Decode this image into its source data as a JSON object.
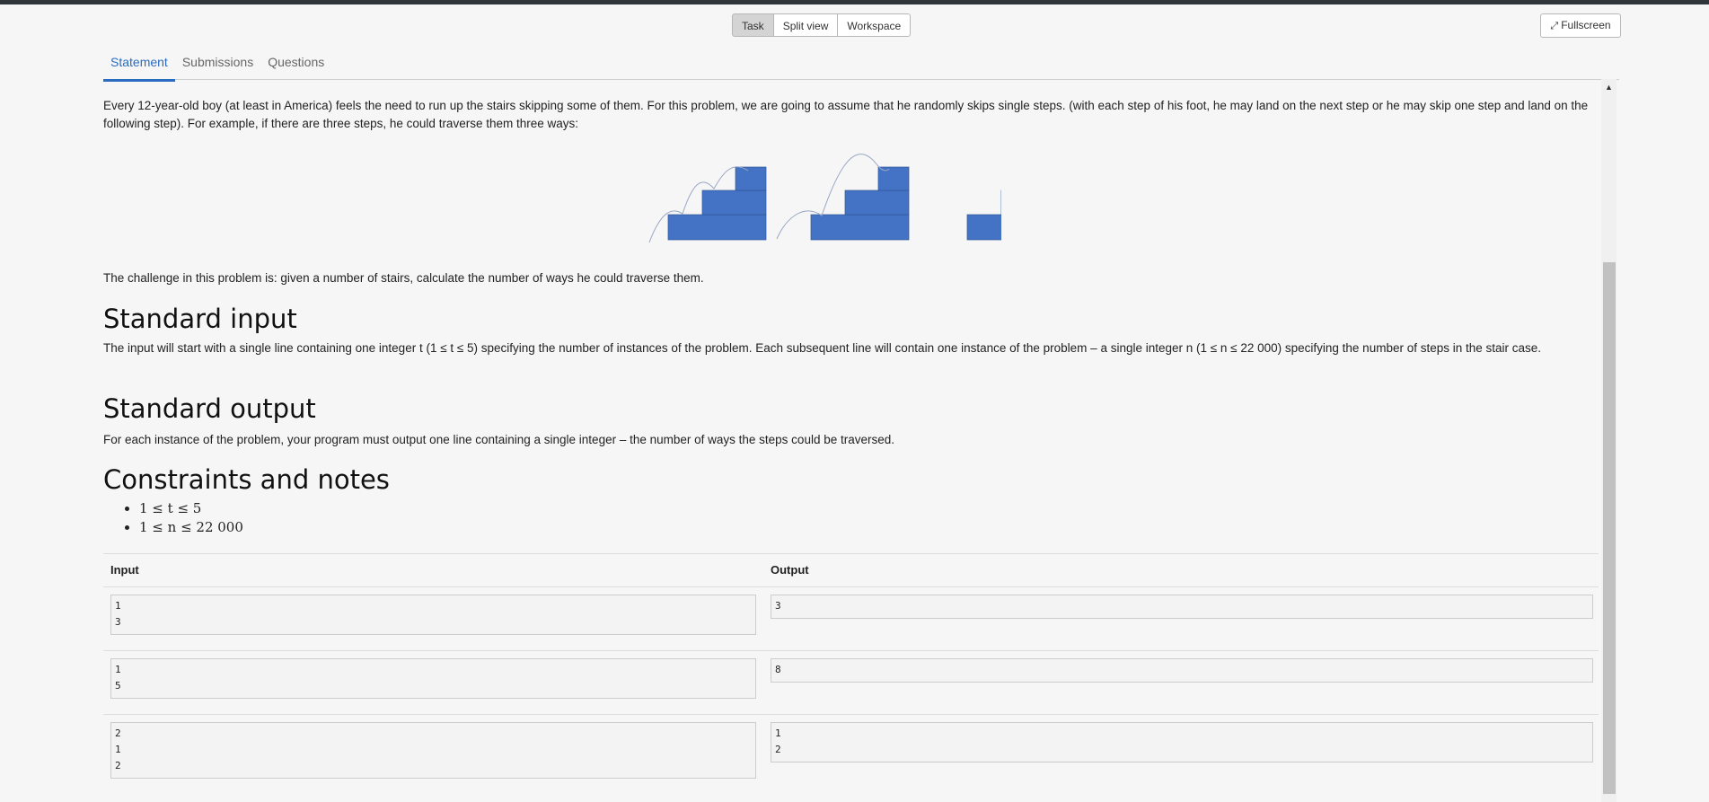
{
  "view_tabs": [
    {
      "label": "Task",
      "active": true
    },
    {
      "label": "Split view",
      "active": false
    },
    {
      "label": "Workspace",
      "active": false
    }
  ],
  "fullscreen_label": "Fullscreen",
  "statement_tabs": [
    {
      "label": "Statement",
      "active": true
    },
    {
      "label": "Submissions",
      "active": false
    },
    {
      "label": "Questions",
      "active": false
    }
  ],
  "statement": {
    "intro": "Every 12-year-old boy (at least in America) feels the need to run up the stairs skipping some of them. For this problem, we are going to assume that he randomly skips single steps. (with each step of his foot, he may land on the next step or he may skip one step and land on the following step). For example, if there are three steps, he could traverse them three ways:",
    "challenge": "The challenge in this problem is: given a number of stairs, calculate the number of ways he could traverse them.",
    "input_title": "Standard input",
    "input_text": "The input will start with a single line containing one integer t (1 ≤ t ≤ 5) specifying the number of instances of the problem. Each subsequent line will contain one instance of the problem – a single integer n (1 ≤ n ≤ 22 000) specifying the number of steps in the stair case.",
    "output_title": "Standard output",
    "output_text": "For each instance of the problem, your program must output one line containing a single integer – the number of ways the steps could be traversed.",
    "constraints_title": "Constraints and notes",
    "constraints": [
      "1 ≤ t ≤ 5",
      "1 ≤ n ≤ 22 000"
    ]
  },
  "examples": {
    "input_header": "Input",
    "output_header": "Output",
    "rows": [
      {
        "input": "1\n3",
        "output": "3"
      },
      {
        "input": "1\n5",
        "output": "8"
      },
      {
        "input": "2\n1\n2",
        "output": "1\n2"
      }
    ]
  },
  "colors": {
    "accent": "#2a6cc0",
    "stair_fill": "#4472c4"
  }
}
